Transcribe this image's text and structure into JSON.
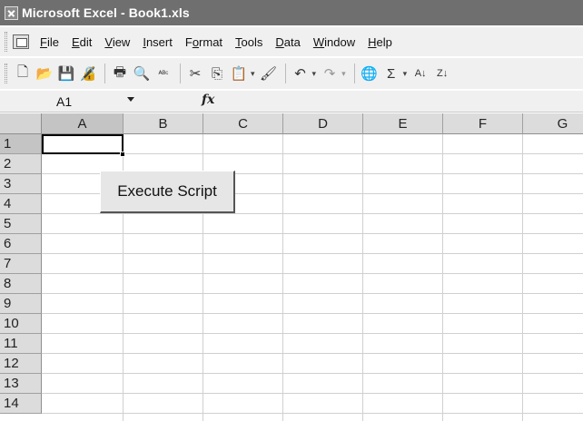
{
  "window": {
    "title": "Microsoft Excel - Book1.xls",
    "icon": "excel-app-icon"
  },
  "menubar": {
    "icon": "workbook-document-icon",
    "items": [
      {
        "label": "File",
        "accel": "F",
        "rest": "ile"
      },
      {
        "label": "Edit",
        "accel": "E",
        "rest": "dit"
      },
      {
        "label": "View",
        "accel": "V",
        "rest": "iew"
      },
      {
        "label": "Insert",
        "accel": "I",
        "rest": "nsert"
      },
      {
        "label": "Format",
        "pre": "F",
        "accel": "o",
        "rest": "rmat"
      },
      {
        "label": "Tools",
        "accel": "T",
        "rest": "ools"
      },
      {
        "label": "Data",
        "accel": "D",
        "rest": "ata"
      },
      {
        "label": "Window",
        "accel": "W",
        "rest": "indow"
      },
      {
        "label": "Help",
        "accel": "H",
        "rest": "elp"
      }
    ]
  },
  "toolbar": {
    "buttons": [
      {
        "name": "new-icon",
        "glyph": "🗋"
      },
      {
        "name": "open-icon",
        "glyph": "📂"
      },
      {
        "name": "save-icon",
        "glyph": "💾"
      },
      {
        "name": "permission-icon",
        "glyph": "🔏"
      },
      {
        "name": "print-icon",
        "glyph": "🖶"
      },
      {
        "name": "print-preview-icon",
        "glyph": "🔍"
      },
      {
        "name": "spelling-icon",
        "glyph": "ᴬᴮᶜ"
      },
      {
        "name": "cut-icon",
        "glyph": "✂"
      },
      {
        "name": "copy-icon",
        "glyph": "⎘"
      },
      {
        "name": "paste-icon",
        "glyph": "📋"
      },
      {
        "name": "format-painter-icon",
        "glyph": "🖌"
      },
      {
        "name": "undo-icon",
        "glyph": "↶"
      },
      {
        "name": "redo-icon",
        "glyph": "↷"
      },
      {
        "name": "hyperlink-icon",
        "glyph": "🌐"
      },
      {
        "name": "autosum-icon",
        "glyph": "Σ"
      },
      {
        "name": "sort-ascending-icon",
        "glyph": "A↓"
      },
      {
        "name": "sort-descending-icon",
        "glyph": "Z↓"
      }
    ]
  },
  "formula_bar": {
    "name_box": "A1",
    "fx_label": "fx",
    "formula": ""
  },
  "grid": {
    "columns": [
      "A",
      "B",
      "C",
      "D",
      "E",
      "F",
      "G"
    ],
    "rows": [
      "1",
      "2",
      "3",
      "4",
      "5",
      "6",
      "7",
      "8",
      "9",
      "10",
      "11",
      "12",
      "13",
      "14"
    ],
    "active_cell": "A1"
  },
  "button": {
    "label": "Execute Script"
  }
}
